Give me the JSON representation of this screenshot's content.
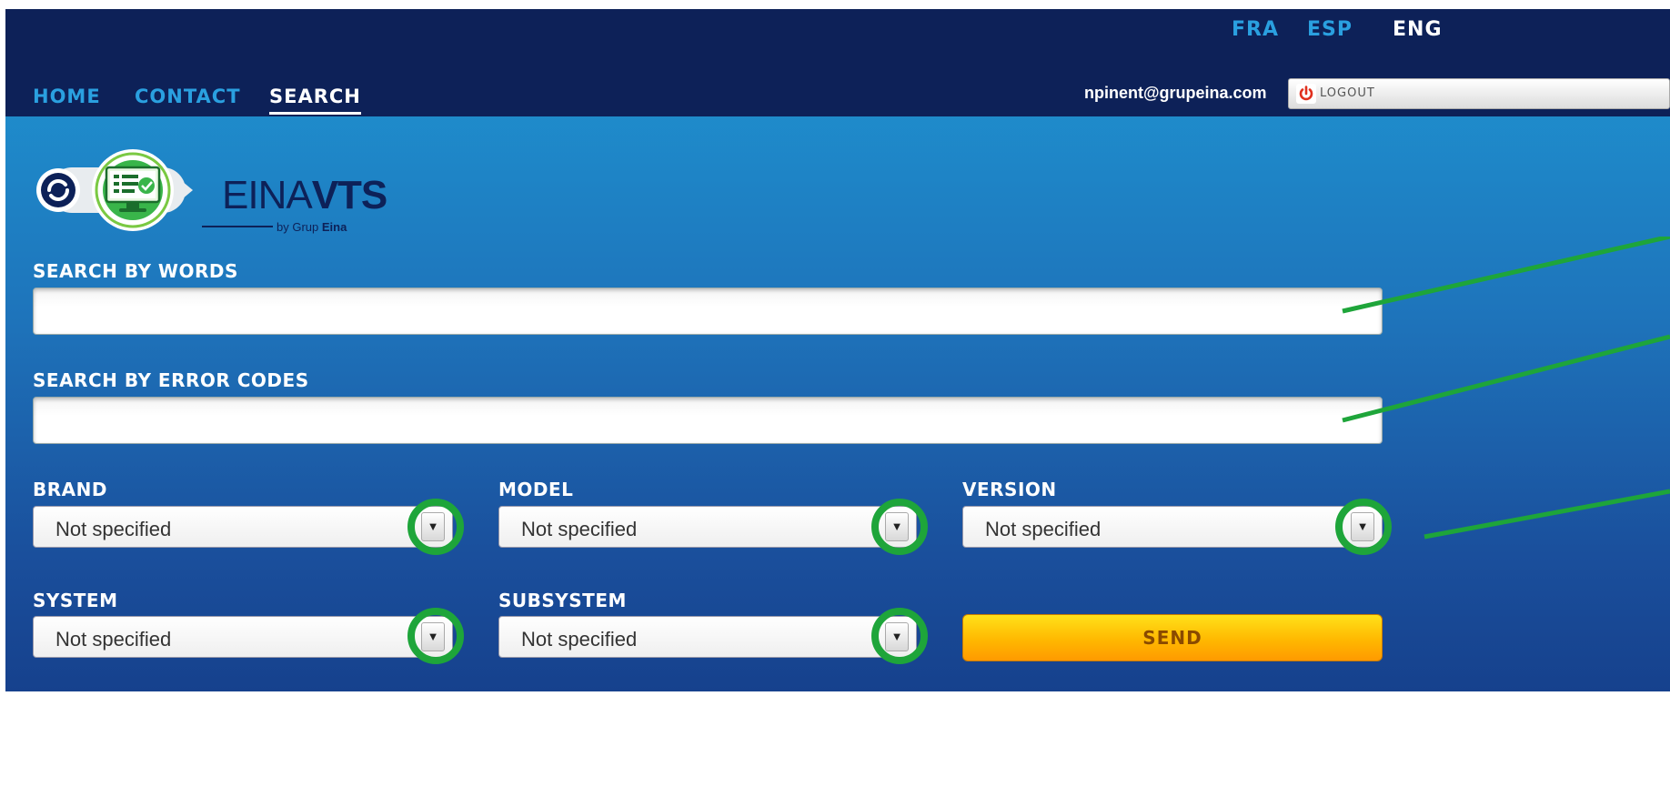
{
  "languages": [
    "FRA",
    "ESP",
    "ENG"
  ],
  "nav": {
    "home": "HOME",
    "contact": "CONTACT",
    "search": "SEARCH"
  },
  "user": {
    "email": "npinent@grupeina.com",
    "logout_label": "LOGOUT"
  },
  "logo": {
    "brand_light": "EINA",
    "brand_bold": "VTS",
    "by_text": "by Grup ",
    "by_bold": "Eina"
  },
  "form": {
    "words_label": "SEARCH BY WORDS",
    "error_codes_label": "SEARCH BY ERROR CODES",
    "words_value": "",
    "error_codes_value": "",
    "brand_label": "BRAND",
    "model_label": "MODEL",
    "version_label": "VERSION",
    "system_label": "SYSTEM",
    "subsystem_label": "SUBSYSTEM",
    "brand_value": "Not specified",
    "model_value": "Not specified",
    "version_value": "Not specified",
    "system_value": "Not specified",
    "subsystem_value": "Not specified",
    "send_label": "SEND"
  },
  "colors": {
    "topbar": "#0d2158",
    "nav_inactive": "#2aa0e0",
    "annotation_green": "#1ea53a",
    "send_button": "#ffb800"
  },
  "icons": [
    "power-icon",
    "monitor-check-icon",
    "chevron-down-icon"
  ]
}
